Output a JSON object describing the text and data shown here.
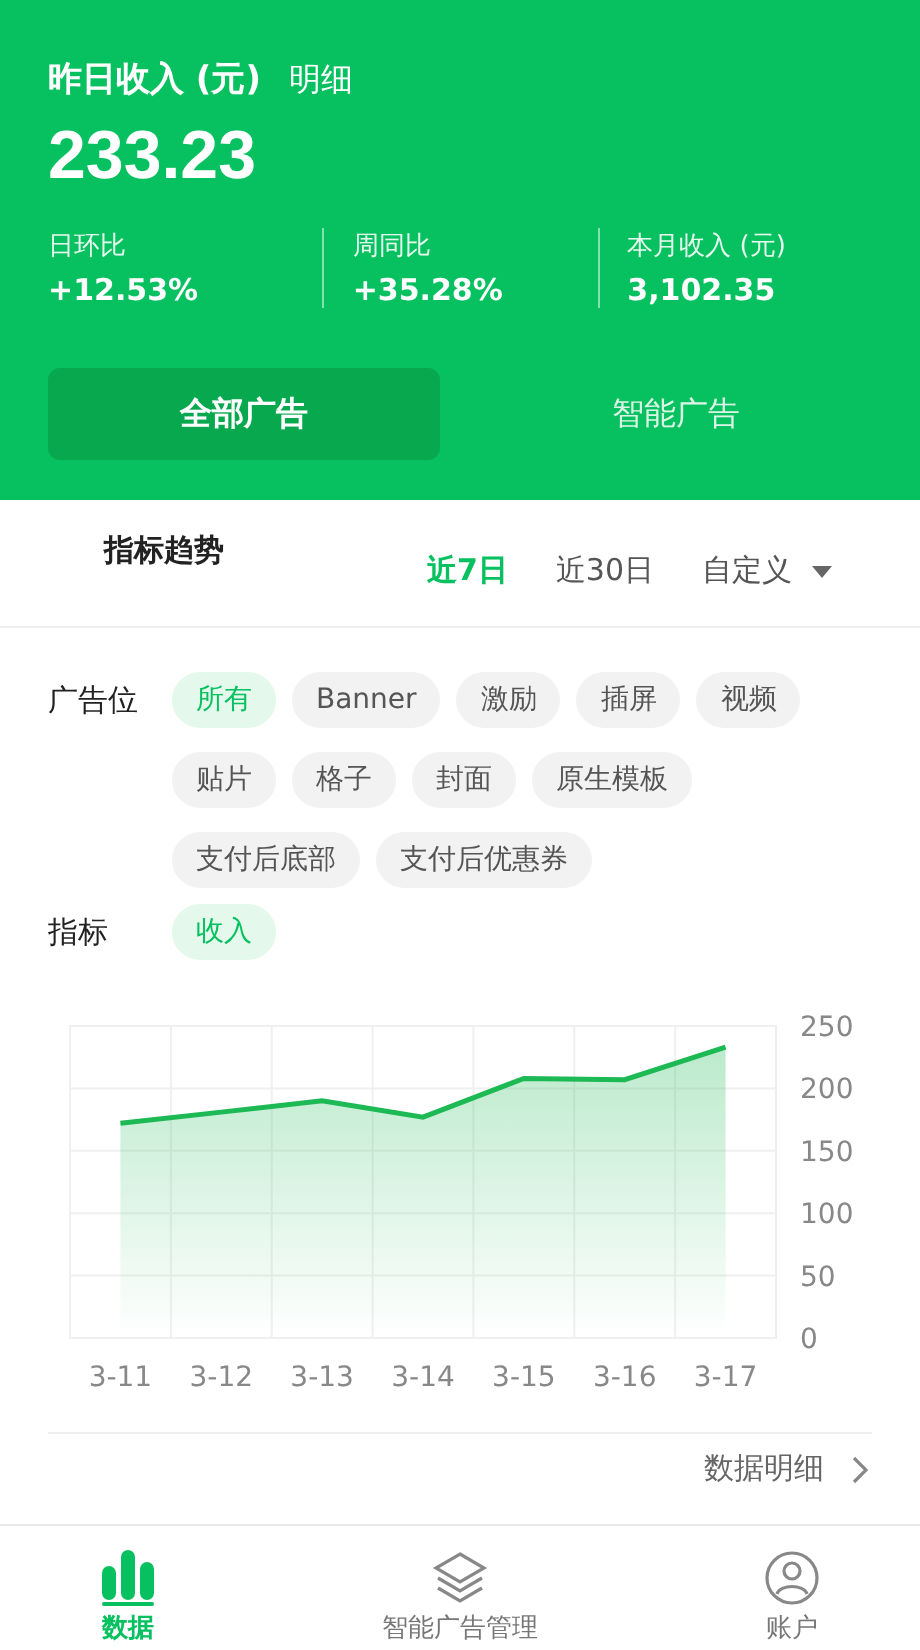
{
  "header": {
    "title": "昨日收入 (元)",
    "detail_link": "明细",
    "amount": "233.23",
    "stats": [
      {
        "label": "日环比",
        "value": "+12.53%"
      },
      {
        "label": "周同比",
        "value": "+35.28%"
      },
      {
        "label": "本月收入 (元)",
        "value": "3,102.35"
      }
    ],
    "tabs": [
      {
        "label": "全部广告",
        "selected": true
      },
      {
        "label": "智能广告",
        "selected": false
      }
    ]
  },
  "trend": {
    "title": "指标趋势",
    "ranges": [
      {
        "label": "近7日",
        "selected": true
      },
      {
        "label": "近30日",
        "selected": false
      },
      {
        "label": "自定义",
        "selected": false,
        "dropdown": true
      }
    ]
  },
  "filters": [
    {
      "label": "广告位",
      "chips": [
        {
          "label": "所有",
          "selected": true
        },
        {
          "label": "Banner",
          "selected": false
        },
        {
          "label": "激励",
          "selected": false
        },
        {
          "label": "插屏",
          "selected": false
        },
        {
          "label": "视频",
          "selected": false
        },
        {
          "label": "贴片",
          "selected": false
        },
        {
          "label": "格子",
          "selected": false
        },
        {
          "label": "封面",
          "selected": false
        },
        {
          "label": "原生模板",
          "selected": false
        },
        {
          "label": "支付后底部",
          "selected": false
        },
        {
          "label": "支付后优惠券",
          "selected": false
        }
      ]
    },
    {
      "label": "指标",
      "chips": [
        {
          "label": "收入",
          "selected": true
        }
      ]
    }
  ],
  "chart_data": {
    "type": "area",
    "categories": [
      "3-11",
      "3-12",
      "3-13",
      "3-14",
      "3-15",
      "3-16",
      "3-17"
    ],
    "grid": true,
    "series": [
      {
        "color": "#1db954",
        "values": [
          172,
          181,
          190,
          177,
          208,
          207,
          233
        ]
      }
    ],
    "ylim": [
      0,
      250
    ],
    "yticks": [
      0,
      50,
      100,
      150,
      200,
      250
    ]
  },
  "detail_link": "数据明细",
  "nav": [
    {
      "label": "数据",
      "selected": true,
      "kind": "chart"
    },
    {
      "label": "智能广告管理",
      "selected": false,
      "kind": "layers"
    },
    {
      "label": "账户",
      "selected": false,
      "kind": "user"
    }
  ]
}
